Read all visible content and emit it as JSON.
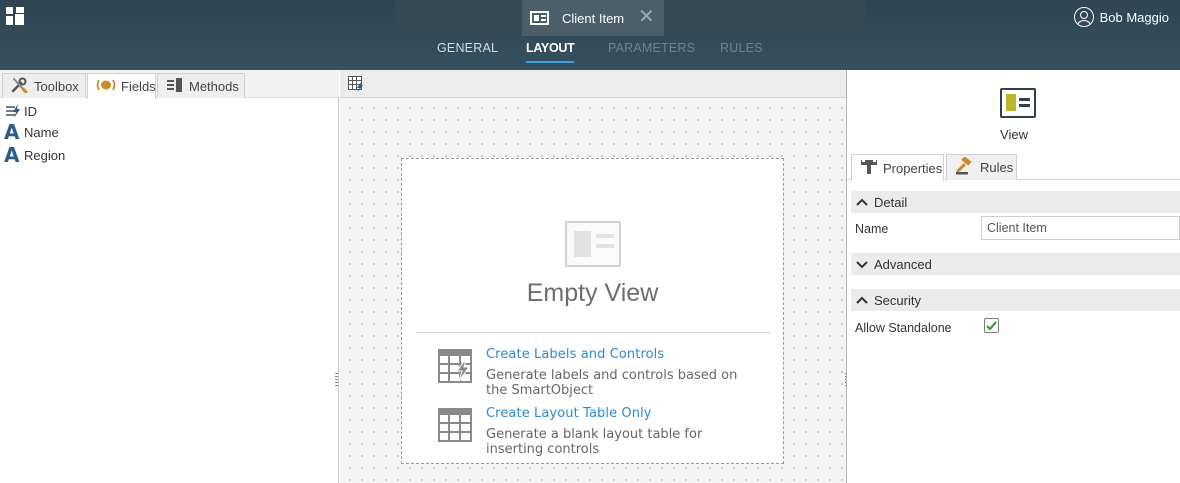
{
  "header": {
    "document_title": "Client Item",
    "user_name": "Bob Maggio",
    "nav_tabs": [
      {
        "label": "GENERAL",
        "active": false
      },
      {
        "label": "LAYOUT",
        "active": true
      },
      {
        "label": "PARAMETERS",
        "active": false
      },
      {
        "label": "RULES",
        "active": false
      }
    ],
    "accent_color": "#3aa0e4"
  },
  "left_panel": {
    "tabs": [
      {
        "label": "Toolbox",
        "icon": "wrench-screwdriver-icon"
      },
      {
        "label": "Fields",
        "icon": "fields-icon",
        "active": true
      },
      {
        "label": "Methods",
        "icon": "methods-icon"
      }
    ],
    "fields": [
      {
        "label": "ID",
        "icon": "autonumber-icon"
      },
      {
        "label": "Name",
        "icon": "text-field-icon"
      },
      {
        "label": "Region",
        "icon": "text-field-icon"
      }
    ]
  },
  "canvas": {
    "empty_title": "Empty View",
    "options": [
      {
        "link": "Create Labels and Controls",
        "description": "Generate labels and controls based on the SmartObject",
        "icon": "table-lightning-icon"
      },
      {
        "link": "Create Layout Table Only",
        "description": "Generate a blank layout table for inserting controls",
        "icon": "table-grid-icon"
      }
    ],
    "link_color": "#2b8ad6"
  },
  "right_panel": {
    "object_type": "View",
    "tabs": [
      {
        "label": "Properties",
        "icon": "properties-icon",
        "active": true
      },
      {
        "label": "Rules",
        "icon": "gavel-icon"
      }
    ],
    "sections": {
      "detail": {
        "label": "Detail",
        "expanded": true
      },
      "advanced": {
        "label": "Advanced",
        "expanded": false
      },
      "security": {
        "label": "Security",
        "expanded": true
      }
    },
    "properties": {
      "name_label": "Name",
      "name_value": "Client Item",
      "allow_standalone_label": "Allow Standalone",
      "allow_standalone_checked": true
    },
    "check_color": "#3a9a3a"
  }
}
